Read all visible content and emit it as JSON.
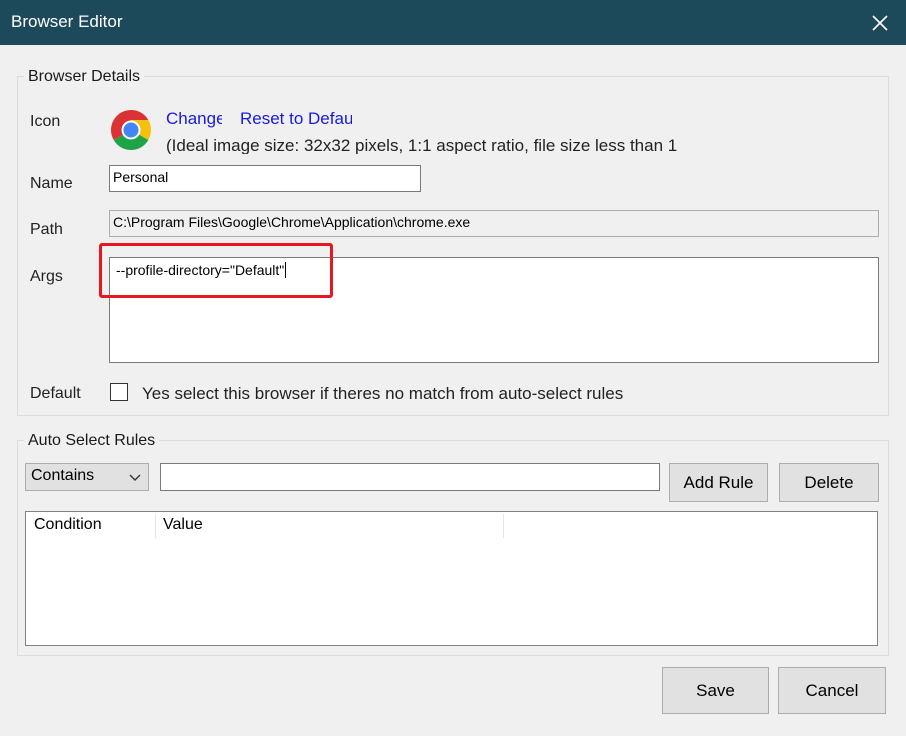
{
  "window": {
    "title": "Browser Editor"
  },
  "browser_details": {
    "legend": "Browser Details",
    "icon_label": "Icon",
    "change_link": "Change",
    "reset_link": "Reset to Default",
    "icon_hint": "(Ideal image size: 32x32 pixels, 1:1 aspect ratio, file size less than 1",
    "name_label": "Name",
    "name_value": "Personal",
    "path_label": "Path",
    "path_value": "C:\\Program Files\\Google\\Chrome\\Application\\chrome.exe",
    "args_label": "Args",
    "args_value": "--profile-directory=\"Default\"",
    "default_label": "Default",
    "default_checkbox_text": "Yes select this browser if theres no match from auto-select rules",
    "default_checked": false
  },
  "auto_select": {
    "legend": "Auto Select Rules",
    "condition_selected": "Contains",
    "rule_value": "",
    "add_rule": "Add Rule",
    "delete": "Delete",
    "columns": [
      "Condition",
      "Value"
    ],
    "rows": []
  },
  "footer": {
    "save": "Save",
    "cancel": "Cancel"
  },
  "colors": {
    "titlebar": "#1d4a5b",
    "link": "#1a1adc",
    "highlight": "#e8161e"
  },
  "icons": {
    "browser_icon": "chrome-logo-icon",
    "close": "close-icon",
    "dropdown": "chevron-down-icon"
  }
}
